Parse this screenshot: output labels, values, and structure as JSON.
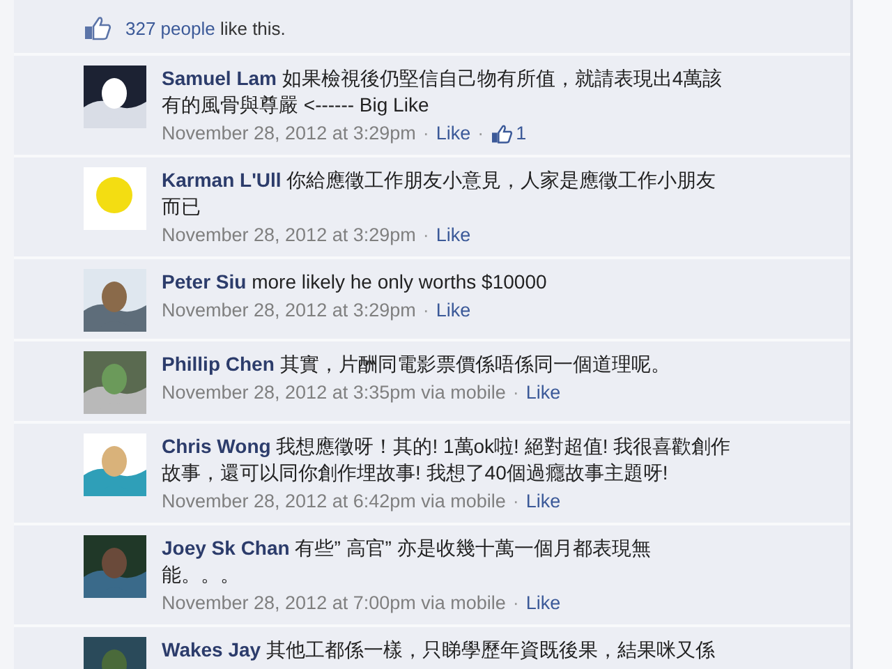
{
  "summary": {
    "count_link": "327 people",
    "text": "like this."
  },
  "comments": [
    {
      "name": "Samuel Lam",
      "lines": [
        "如果檢視後仍堅信自己物有所值，就請表現出4萬該",
        "有的風骨與尊嚴 <------ Big Like"
      ],
      "meta": [
        {
          "kind": "time",
          "text": "November 28, 2012 at 3:29pm"
        },
        {
          "kind": "sep",
          "text": "·"
        },
        {
          "kind": "link",
          "text": "Like"
        },
        {
          "kind": "sep",
          "text": "·"
        },
        {
          "kind": "count",
          "text": "1"
        }
      ]
    },
    {
      "name": "Karman L'Ull",
      "lines": [
        "你給應徵工作朋友小意見，人家是應徵工作小朋友",
        "而已"
      ],
      "meta": [
        {
          "kind": "time",
          "text": "November 28, 2012 at 3:29pm"
        },
        {
          "kind": "sep",
          "text": "·"
        },
        {
          "kind": "link",
          "text": "Like"
        }
      ]
    },
    {
      "name": "Peter Siu",
      "lines": [
        "more likely he only worths $10000"
      ],
      "meta": [
        {
          "kind": "time",
          "text": "November 28, 2012 at 3:29pm"
        },
        {
          "kind": "sep",
          "text": "·"
        },
        {
          "kind": "link",
          "text": "Like"
        }
      ]
    },
    {
      "name": "Phillip Chen",
      "lines": [
        "其實，片酬同電影票價係唔係同一個道理呢。"
      ],
      "meta": [
        {
          "kind": "time",
          "text": "November 28, 2012 at 3:35pm via mobile"
        },
        {
          "kind": "sep",
          "text": "·"
        },
        {
          "kind": "link",
          "text": "Like"
        }
      ]
    },
    {
      "name": "Chris Wong",
      "lines": [
        "我想應徵呀！其的! 1萬ok啦! 絕對超值! 我很喜歡創作",
        "故事，還可以同你創作埋故事! 我想了40個過癮故事主題呀!"
      ],
      "meta": [
        {
          "kind": "time",
          "text": "November 28, 2012 at 6:42pm via mobile"
        },
        {
          "kind": "sep",
          "text": "·"
        },
        {
          "kind": "link",
          "text": "Like"
        }
      ]
    },
    {
      "name": "Joey Sk Chan",
      "lines": [
        "有些” 高官” 亦是收幾十萬一個月都表現無",
        "能。。。"
      ],
      "meta": [
        {
          "kind": "time",
          "text": "November 28, 2012 at 7:00pm via mobile"
        },
        {
          "kind": "sep",
          "text": "·"
        },
        {
          "kind": "link",
          "text": "Like"
        }
      ]
    },
    {
      "name": "Wakes Jay",
      "lines": [
        "其他工都係一樣，只睇學歷年資既後果，結果咪又係"
      ]
    }
  ]
}
